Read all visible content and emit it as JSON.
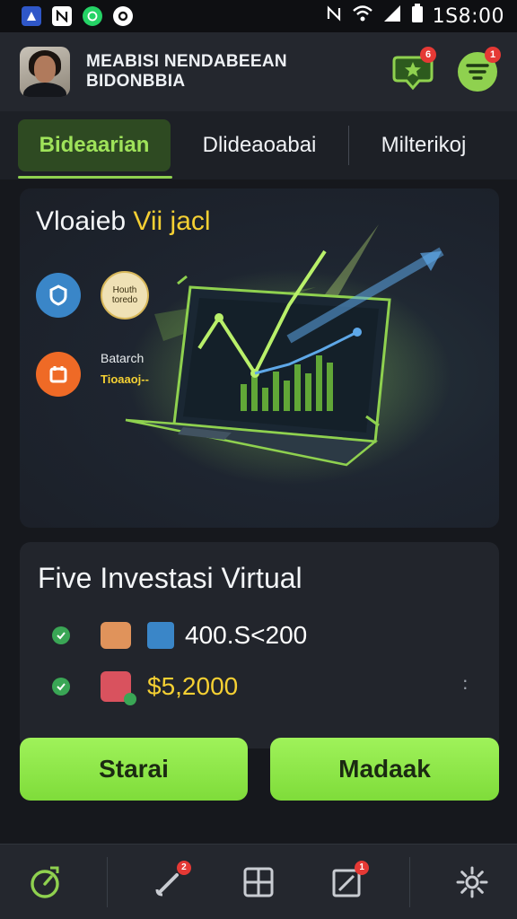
{
  "status_bar": {
    "time": "1S8:00",
    "icons": [
      "app-icon-blue",
      "app-icon-n",
      "app-icon-whatsapp",
      "app-icon-circle",
      "nfc-icon",
      "wifi-icon",
      "signal-icon",
      "battery-icon"
    ]
  },
  "header": {
    "title_line1": "MEABISI NENDABEEAN",
    "title_line2": "BIDONBBIA",
    "badges": {
      "rewards": "6",
      "filter": "1"
    }
  },
  "tabs": [
    {
      "label": "Bideaarian",
      "active": true
    },
    {
      "label": "Dlideaoabai",
      "active": false
    },
    {
      "label": "Milterikoj",
      "active": false
    }
  ],
  "hero": {
    "title_plain": "Vloaieb",
    "title_highlight": "Vii jacl",
    "item1_label_line1": "Houth",
    "item1_label_line2": "toredo",
    "item2_label_line1": "Batarch",
    "item2_label_line2": "Tioaaoj--"
  },
  "investment": {
    "title": "Five Investasi Virtual",
    "rows": [
      {
        "value": "400.S<200",
        "color": "#ffffff"
      },
      {
        "value": "$5,2000",
        "color": "#f5d033"
      }
    ]
  },
  "buttons": {
    "primary": "Starai",
    "secondary": "Madaak"
  },
  "bottom_nav": {
    "badges": {
      "tool": "2",
      "chart": "1"
    }
  },
  "colors": {
    "accent_green": "#8fd14f",
    "highlight_yellow": "#f5d033",
    "badge_red": "#e53935"
  }
}
